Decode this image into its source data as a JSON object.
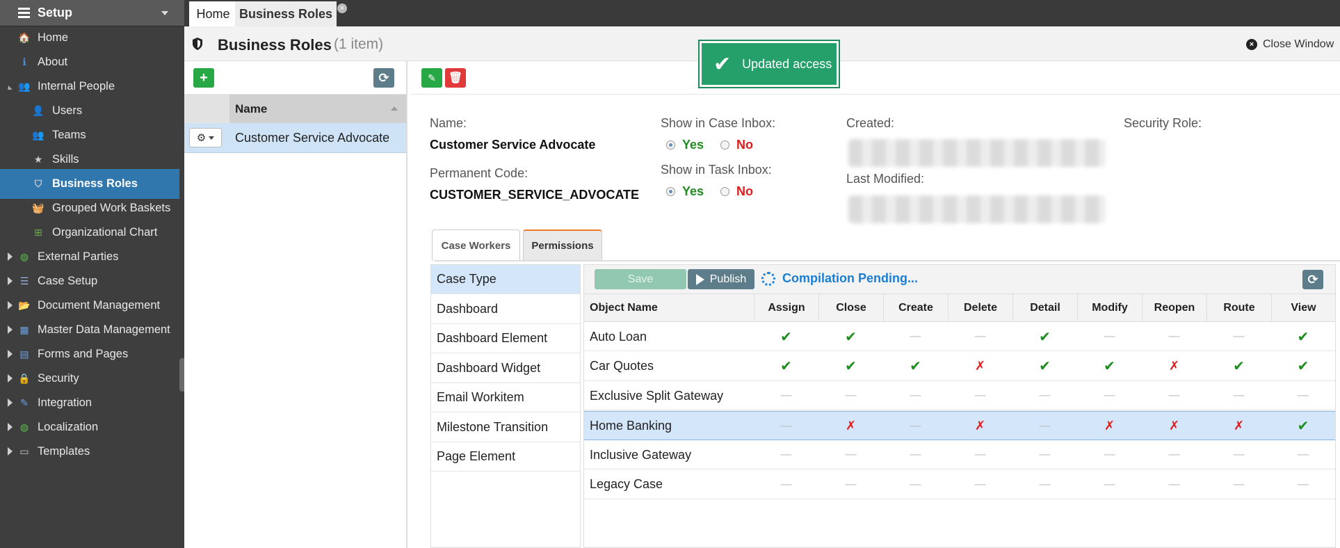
{
  "sidebar": {
    "title": "Setup",
    "items": [
      {
        "label": "Home",
        "icon": "home-icon"
      },
      {
        "label": "About",
        "icon": "info-icon"
      },
      {
        "label": "Internal People",
        "icon": "people-icon"
      },
      {
        "label": "Users",
        "icon": "user-icon"
      },
      {
        "label": "Teams",
        "icon": "team-icon"
      },
      {
        "label": "Skills",
        "icon": "star-icon"
      },
      {
        "label": "Business Roles",
        "icon": "shield-icon"
      },
      {
        "label": "Grouped Work Baskets",
        "icon": "basket-icon"
      },
      {
        "label": "Organizational Chart",
        "icon": "org-chart-icon"
      },
      {
        "label": "External Parties",
        "icon": "globe-icon"
      },
      {
        "label": "Case Setup",
        "icon": "case-icon"
      },
      {
        "label": "Document Management",
        "icon": "folder-icon"
      },
      {
        "label": "Master Data Management",
        "icon": "table-icon"
      },
      {
        "label": "Forms and Pages",
        "icon": "form-icon"
      },
      {
        "label": "Security",
        "icon": "lock-icon"
      },
      {
        "label": "Integration",
        "icon": "plug-icon"
      },
      {
        "label": "Localization",
        "icon": "globe-icon"
      },
      {
        "label": "Templates",
        "icon": "template-icon"
      }
    ],
    "active_item": "Business Roles"
  },
  "tabs": [
    {
      "label": "Home"
    },
    {
      "label": "Business Roles"
    }
  ],
  "header": {
    "title": "Business Roles",
    "count": "(1 item)",
    "close_label": "Close Window"
  },
  "toast": {
    "message": "Updated access"
  },
  "list": {
    "column_header": "Name",
    "rows": [
      {
        "name": "Customer Service Advocate"
      }
    ]
  },
  "detail": {
    "name_label": "Name:",
    "name_value": "Customer Service Advocate",
    "code_label": "Permanent Code:",
    "code_value": "CUSTOMER_SERVICE_ADVOCATE",
    "case_inbox_label": "Show in Case Inbox:",
    "task_inbox_label": "Show in Task Inbox:",
    "yes_label": "Yes",
    "no_label": "No",
    "case_inbox_value": "Yes",
    "task_inbox_value": "Yes",
    "created_label": "Created:",
    "modified_label": "Last Modified:",
    "security_role_label": "Security Role:"
  },
  "sub_tabs": [
    {
      "label": "Case Workers"
    },
    {
      "label": "Permissions"
    }
  ],
  "object_types": [
    "Case Type",
    "Dashboard",
    "Dashboard Element",
    "Dashboard Widget",
    "Email Workitem",
    "Milestone Transition",
    "Page Element"
  ],
  "permissions_toolbar": {
    "save_label": "Save",
    "publish_label": "Publish",
    "status": "Compilation Pending..."
  },
  "permissions": {
    "columns": [
      "Object Name",
      "Assign",
      "Close",
      "Create",
      "Delete",
      "Detail",
      "Modify",
      "Reopen",
      "Route",
      "View"
    ],
    "rows": [
      {
        "name": "Auto Loan",
        "values": [
          "yes",
          "yes",
          "none",
          "none",
          "yes",
          "none",
          "none",
          "none",
          "yes"
        ]
      },
      {
        "name": "Car Quotes",
        "values": [
          "yes",
          "yes",
          "yes",
          "no",
          "yes",
          "yes",
          "no",
          "yes",
          "yes"
        ]
      },
      {
        "name": "Exclusive Split Gateway",
        "values": [
          "none",
          "none",
          "none",
          "none",
          "none",
          "none",
          "none",
          "none",
          "none"
        ]
      },
      {
        "name": "Home Banking",
        "values": [
          "none",
          "no",
          "none",
          "no",
          "none",
          "no",
          "no",
          "no",
          "yes"
        ]
      },
      {
        "name": "Inclusive Gateway",
        "values": [
          "none",
          "none",
          "none",
          "none",
          "none",
          "none",
          "none",
          "none",
          "none"
        ]
      },
      {
        "name": "Legacy Case",
        "values": [
          "none",
          "none",
          "none",
          "none",
          "none",
          "none",
          "none",
          "none",
          "none"
        ]
      }
    ],
    "highlighted_row": "Home Banking",
    "symbols": {
      "yes": "✔",
      "no": "✗",
      "none": "—"
    }
  },
  "colors": {
    "sidebar_bg": "#3e3e3e",
    "active_nav": "#2f77ad",
    "toast_bg": "#25a06b",
    "yes_green": "#1e8c1e",
    "no_red": "#e01b1b",
    "link_blue": "#1a7fd6"
  }
}
